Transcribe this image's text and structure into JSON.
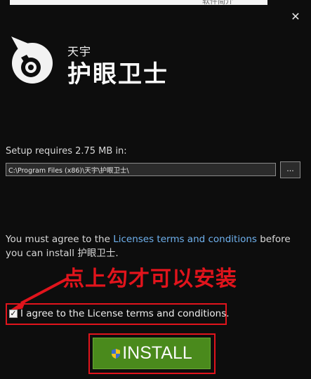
{
  "window": {
    "top_overflow_text": "软件简介",
    "close_glyph": "✕",
    "brand_small": "天宇",
    "brand_big": "护眼卫士"
  },
  "install": {
    "requires_text": "Setup requires 2.75 MB in:",
    "path_value": "C:\\Program Files (x86)\\天宇\\护眼卫士\\",
    "browse_label": "...",
    "agree_prefix": "You must agree to the ",
    "agree_link": "Licenses terms and conditions",
    "agree_suffix": " before you can install 护眼卫士.",
    "checkbox_checked": true,
    "checkbox_glyph": "✓",
    "checkbox_label": "I agree to the License terms and conditions.",
    "install_label": "INSTALL"
  },
  "annotation": {
    "text": "点上勾才可以安装",
    "color": "#e1141c"
  },
  "colors": {
    "background": "#0d0d0d",
    "link": "#6fb1ee",
    "install_green": "#4a8a1c",
    "annotation_red": "#e1141c"
  },
  "icons": [
    "app-logo-icon",
    "close-icon",
    "shield-icon",
    "arrow-icon"
  ]
}
